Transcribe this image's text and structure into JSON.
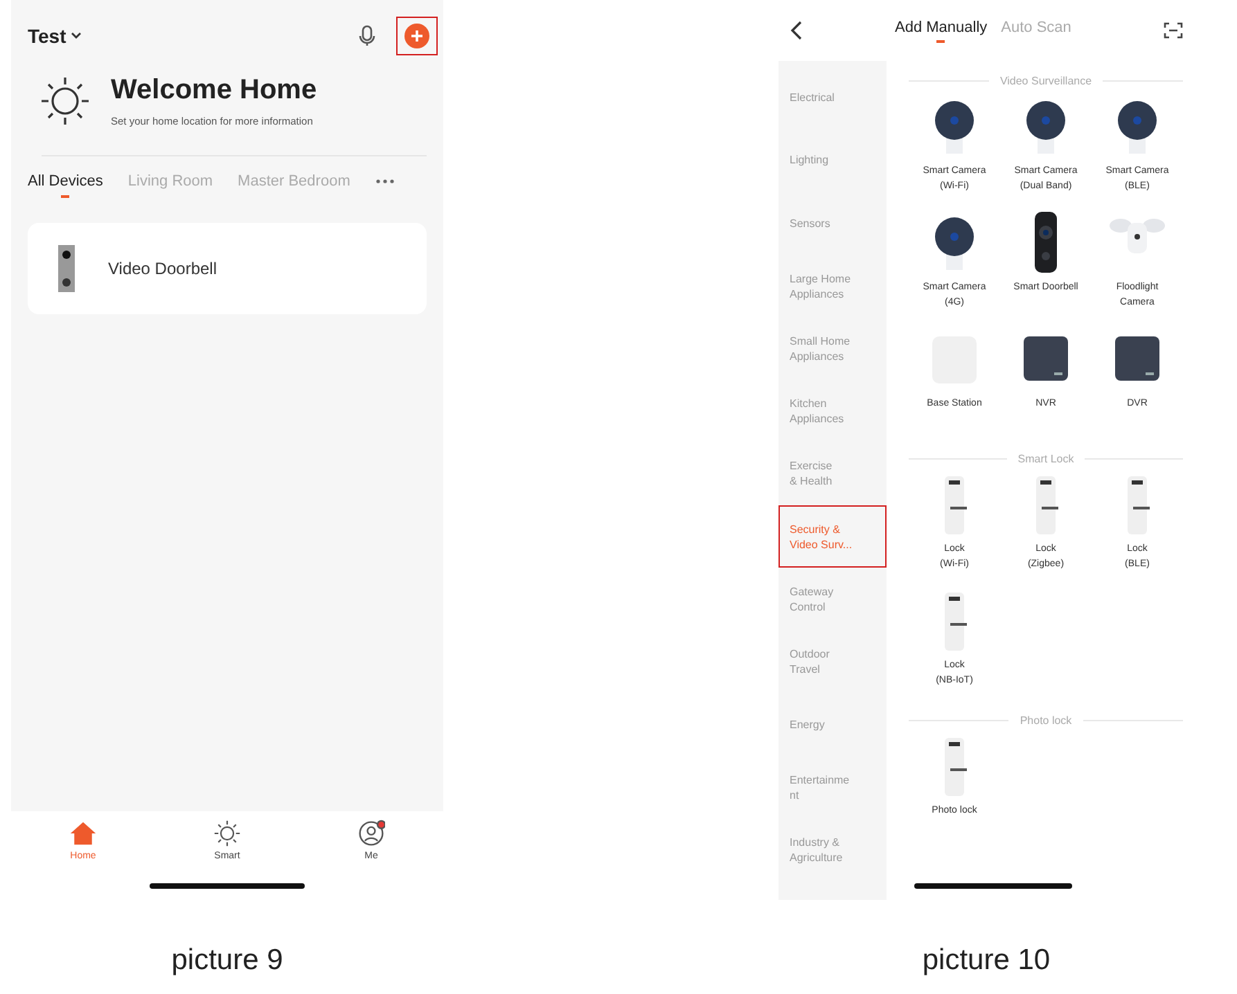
{
  "home_screen": {
    "home_menu": "Test",
    "add_button": {
      "highlighted": true
    },
    "welcome": {
      "title": "Welcome Home",
      "subtitle": "Set your home location for more information"
    },
    "room_tabs": [
      {
        "label": "All Devices",
        "selected": true
      },
      {
        "label": "Living Room",
        "selected": false
      },
      {
        "label": "Master Bedroom",
        "selected": false
      }
    ],
    "devices": [
      {
        "name": "Video Doorbell"
      }
    ],
    "nav": [
      {
        "label": "Home",
        "kind": "home",
        "selected": true,
        "badge": false
      },
      {
        "label": "Smart",
        "kind": "smart",
        "selected": false,
        "badge": false
      },
      {
        "label": "Me",
        "kind": "me",
        "selected": false,
        "badge": true
      }
    ],
    "caption": "picture 9"
  },
  "add_screen": {
    "tabs": [
      {
        "label": "Add Manually",
        "selected": true
      },
      {
        "label": "Auto Scan",
        "selected": false
      }
    ],
    "categories": [
      {
        "label": "Electrical",
        "selected": false
      },
      {
        "label": "Lighting",
        "selected": false
      },
      {
        "label": "Sensors",
        "selected": false
      },
      {
        "label": "Large Home\nAppliances",
        "selected": false
      },
      {
        "label": "Small Home\nAppliances",
        "selected": false
      },
      {
        "label": "Kitchen\nAppliances",
        "selected": false
      },
      {
        "label": "Exercise\n& Health",
        "selected": false
      },
      {
        "label": "Security &\nVideo Surv...",
        "selected": true,
        "highlighted": true
      },
      {
        "label": "Gateway\nControl",
        "selected": false
      },
      {
        "label": "Outdoor\nTravel",
        "selected": false
      },
      {
        "label": "Energy",
        "selected": false
      },
      {
        "label": "Entertainme\nnt",
        "selected": false
      },
      {
        "label": "Industry &\nAgriculture",
        "selected": false
      }
    ],
    "sections": [
      {
        "title": "Video Surveillance",
        "items": [
          {
            "label": "Smart Camera\n(Wi-Fi)",
            "kind": "camera"
          },
          {
            "label": "Smart Camera\n(Dual Band)",
            "kind": "camera"
          },
          {
            "label": "Smart Camera\n(BLE)",
            "kind": "camera"
          },
          {
            "label": "Smart Camera\n(4G)",
            "kind": "camera"
          },
          {
            "label": "Smart Doorbell",
            "kind": "doorbell"
          },
          {
            "label": "Floodlight\nCamera",
            "kind": "floodlight"
          },
          {
            "label": "Base Station",
            "kind": "base"
          },
          {
            "label": "NVR",
            "kind": "recorder"
          },
          {
            "label": "DVR",
            "kind": "recorder"
          }
        ]
      },
      {
        "title": "Smart Lock",
        "items": [
          {
            "label": "Lock\n(Wi-Fi)",
            "kind": "lock"
          },
          {
            "label": "Lock\n(Zigbee)",
            "kind": "lock"
          },
          {
            "label": "Lock\n(BLE)",
            "kind": "lock"
          },
          {
            "label": "Lock\n(NB-IoT)",
            "kind": "lock"
          }
        ]
      },
      {
        "title": "Photo lock",
        "items": [
          {
            "label": "Photo lock",
            "kind": "lock"
          }
        ]
      }
    ],
    "caption": "picture 10"
  }
}
